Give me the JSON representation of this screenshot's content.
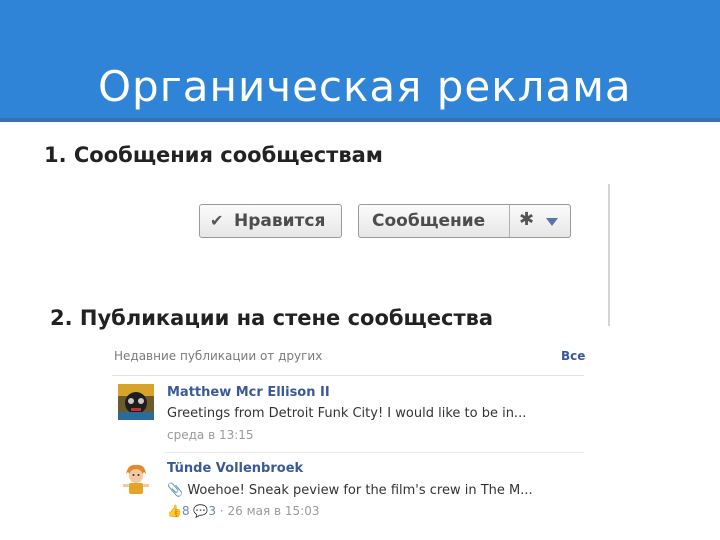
{
  "slide": {
    "title": "Органическая реклама",
    "point1": "1. Сообщения сообществам",
    "point2": "2. Публикации на стене сообщества"
  },
  "page_buttons": {
    "like_label": "Нравится",
    "message_label": "Сообщение",
    "like_icon": "checkmark-icon",
    "settings_icon": "gear-icon",
    "dropdown_icon": "caret-down-icon",
    "caret_color": "#5b74a8"
  },
  "feed": {
    "title": "Недавние публикации от других",
    "all_link": "Все",
    "posts": [
      {
        "author": "Matthew Mcr Ellison II",
        "text": "Greetings from Detroit Funk City! I would like to be in...",
        "time": "среда в 13:15"
      },
      {
        "author": "Tünde Vollenbroek",
        "text": "Woehoe! Sneak peview for the film's crew in The M...",
        "likes": "8",
        "comments": "3",
        "time": "26 мая в 15:03"
      }
    ]
  },
  "colors": {
    "header": "#2f84d8",
    "link": "#3b5998"
  }
}
